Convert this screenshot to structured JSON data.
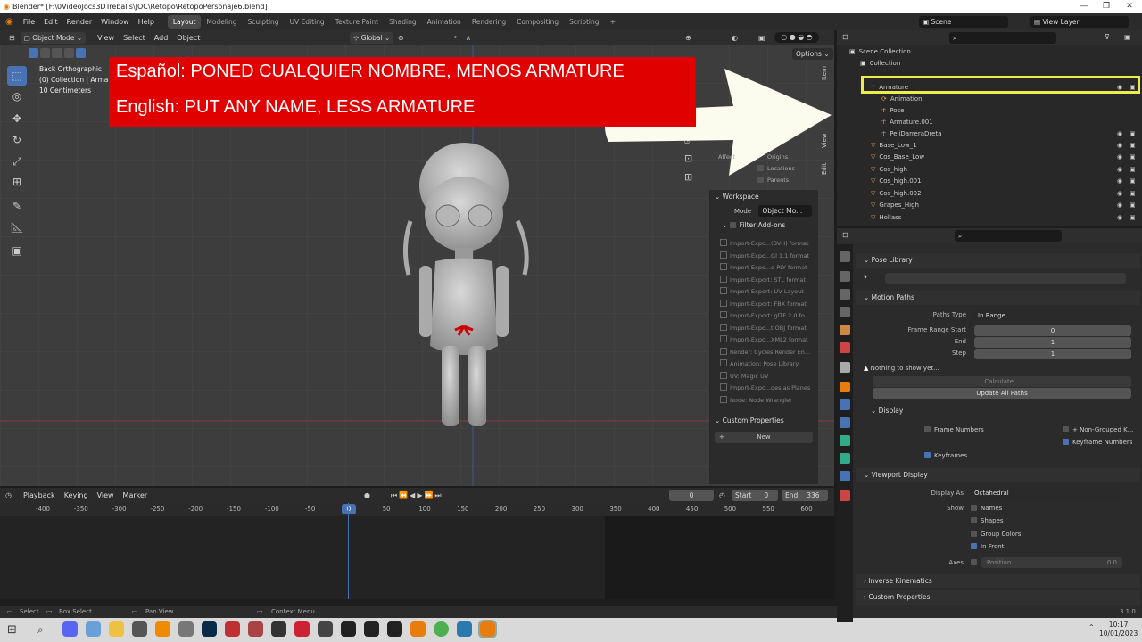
{
  "window": {
    "title": "Blender* [F:\\0VideoJocs3DTreballs\\JOC\\Retopo\\RetopoPersonaje6.blend]"
  },
  "menu": [
    "File",
    "Edit",
    "Render",
    "Window",
    "Help"
  ],
  "workspaces": [
    "Layout",
    "Modeling",
    "Sculpting",
    "UV Editing",
    "Texture Paint",
    "Shading",
    "Animation",
    "Rendering",
    "Compositing",
    "Scripting"
  ],
  "scene_label": "Scene",
  "view_layer_label": "View Layer",
  "viewport": {
    "mode": "Object Mode",
    "menus": [
      "View",
      "Select",
      "Add",
      "Object"
    ],
    "transform": "Global",
    "options": "Options",
    "info": [
      "Back Orthographic",
      "(0) Collection | Armature",
      "10 Centimeters"
    ]
  },
  "banner": {
    "es": "Español: PONED CUALQUIER NOMBRE, MENOS ARMATURE",
    "en": "English: PUT ANY NAME, LESS ARMATURE"
  },
  "npanel": {
    "tabs": [
      "Item",
      "View",
      "Edit"
    ],
    "affect_label": "Affect",
    "affect_origins": "Origins",
    "affect_locations": "Locations",
    "affect_parents": "Parents",
    "workspace": "Workspace",
    "mode_label": "Mode",
    "mode_value": "Object Mo...",
    "filter_addons": "Filter Add-ons",
    "addons": [
      "Import-Expo...(BVH) format",
      "Import-Expo...Gl 1.1 format",
      "Import-Expo...d PLY format",
      "Import-Export: STL format",
      "Import-Export: UV Layout",
      "Import-Export: FBX format",
      "Import-Export: glTF 2.0 fo...",
      "Import-Expo...t OBJ format",
      "Import-Expo...XML2 format",
      "Render: Cycles Render En...",
      "Animation: Pose Library",
      "UV: Magic UV",
      "Import-Expo...ges as Planes",
      "Node: Node Wrangler"
    ],
    "custom_properties": "Custom Properties",
    "new": "New"
  },
  "timeline": {
    "menus": [
      "Playback",
      "Keying",
      "View",
      "Marker"
    ],
    "current": "0",
    "start_label": "Start",
    "start": "0",
    "end_label": "End",
    "end": "336",
    "ticks": [
      "-400",
      "-350",
      "-300",
      "-250",
      "-200",
      "-150",
      "-100",
      "-50",
      "0",
      "50",
      "100",
      "150",
      "200",
      "250",
      "300",
      "350",
      "400",
      "450",
      "500",
      "550",
      "600"
    ]
  },
  "status": {
    "select": "Select",
    "box_select": "Box Select",
    "pan_view": "Pan View",
    "context_menu": "Context Menu",
    "version": "3.1.0"
  },
  "outliner": {
    "rows": [
      {
        "label": "Scene Collection",
        "indent": 0
      },
      {
        "label": "Collection",
        "indent": 1
      },
      {
        "label": "Armature",
        "indent": 2
      },
      {
        "label": "Animation",
        "indent": 3
      },
      {
        "label": "Pose",
        "indent": 3
      },
      {
        "label": "Armature.001",
        "indent": 3
      },
      {
        "label": "PeliDarreraDreta",
        "indent": 3
      },
      {
        "label": "Base_Low_1",
        "indent": 2
      },
      {
        "label": "Cos_Base_Low",
        "indent": 2
      },
      {
        "label": "Cos_high",
        "indent": 2
      },
      {
        "label": "Cos_high.001",
        "indent": 2
      },
      {
        "label": "Cos_high.002",
        "indent": 2
      },
      {
        "label": "Grapes_High",
        "indent": 2
      },
      {
        "label": "Hollass",
        "indent": 2
      }
    ]
  },
  "properties": {
    "pose_library": "Pose Library",
    "motion_paths": "Motion Paths",
    "paths_type_label": "Paths Type",
    "paths_type": "In Range",
    "frame_range_start_label": "Frame Range Start",
    "frame_range_start": "0",
    "end_label": "End",
    "end": "1",
    "step_label": "Step",
    "step": "1",
    "nothing": "Nothing to show yet...",
    "calculate": "Calculate...",
    "update_all": "Update All Paths",
    "display": "Display",
    "frame_numbers": "Frame Numbers",
    "non_grouped": "+ Non-Grouped K...",
    "keyframe_numbers": "Keyframe Numbers",
    "keyframes": "Keyframes",
    "viewport_display": "Viewport Display",
    "display_as_label": "Display As",
    "display_as": "Octahedral",
    "show_label": "Show",
    "names": "Names",
    "shapes": "Shapes",
    "group_colors": "Group Colors",
    "in_front": "In Front",
    "axes_label": "Axes",
    "axes_pos": "Position",
    "axes_val": "0.0",
    "inverse_kinematics": "Inverse Kinematics",
    "custom_properties": "Custom Properties"
  },
  "clock": {
    "time": "10:17",
    "date": "10/01/2023"
  }
}
